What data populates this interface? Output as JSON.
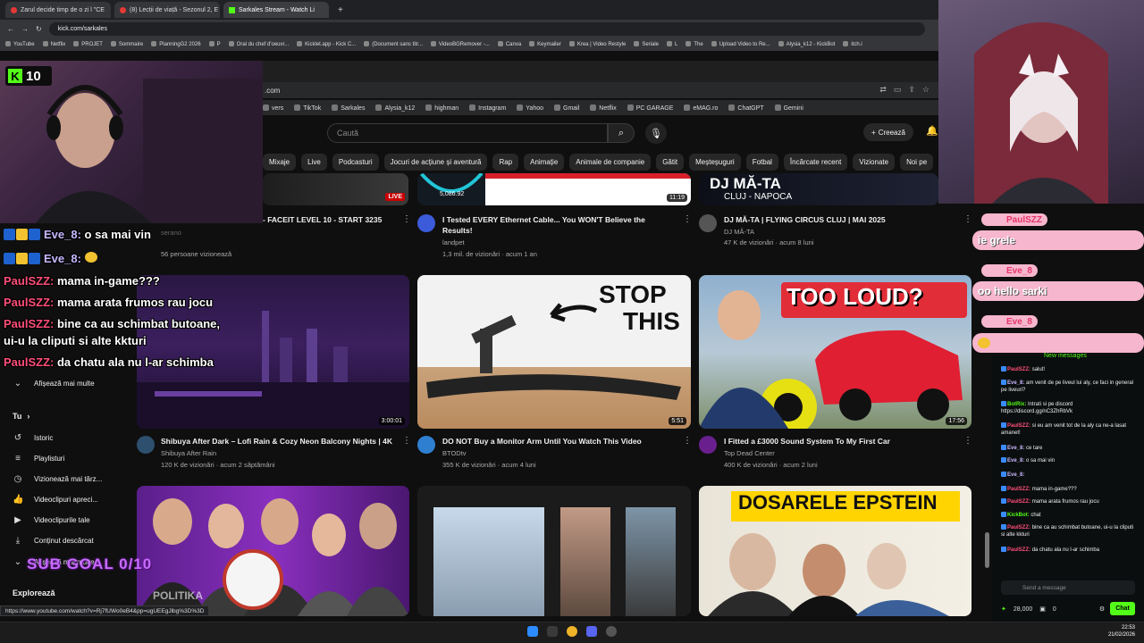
{
  "outer_browser": {
    "tabs": [
      {
        "label": "Zarul decide timp de o zi l \"CE",
        "icon": "youtube-icon"
      },
      {
        "label": "(8) Lecții de viață - Sezonul 2, E",
        "icon": "youtube-icon"
      },
      {
        "label": "Sarkales Stream - Watch Li",
        "icon": "kick-icon"
      }
    ],
    "url": "kick.com/sarkales",
    "bookmarks": [
      "YouTube",
      "Netflix",
      "PROJET",
      "Sommaire",
      "PlanningG2 2026",
      "P",
      "Oral du chef d'oeuvr...",
      "Kicklet.app - Kick C...",
      "(Document sans titr...",
      "VideoBGRemover -...",
      "Canva",
      "Keymailer",
      "Krea | Video Restyle",
      "Seriale",
      "L",
      "The",
      "Upload Video to Re...",
      "Alysia_k12 - KickBot",
      "itch.i"
    ]
  },
  "inner_browser": {
    "url": ".com",
    "bookmarks": [
      "vers",
      "TikTok",
      "Sarkales",
      "Alysia_k12",
      "highman",
      "Instagram",
      "Yahoo",
      "Gmail",
      "Netflix",
      "PC GARAGE",
      "eMAG.ro",
      "ChatGPT",
      "Gemini"
    ]
  },
  "youtube": {
    "search_placeholder": "Caută",
    "create_label": "Creează",
    "chips": [
      "Mixaje",
      "Live",
      "Podcasturi",
      "Jocuri de acțiune și aventură",
      "Rap",
      "Animație",
      "Animale de companie",
      "Gătit",
      "Meșteșuguri",
      "Fotbal",
      "Încărcate recent",
      "Vizionate",
      "Noi pe"
    ],
    "row1": [
      {
        "title": "- FACEIT LEVEL 10 - START 3235",
        "channel": "serano",
        "meta": "56 persoane vizionează",
        "live_badge": "LIVE"
      },
      {
        "title": "I Tested EVERY Ethernet Cable... You WON'T Believe the Results!",
        "channel": "landpet",
        "meta": "1,3 mil. de vizionări · acum 1 an",
        "thumb_text": "5,086.92"
      },
      {
        "title": "DJ MĂ-TA | FLYING CIRCUS CLUJ | MAI 2025",
        "channel": "DJ MĂ-TA",
        "meta": "47 K de vizionări · acum 8 luni",
        "duration": "11:19",
        "thumb_text": "DJ MĂ-TA",
        "thumb_sub": "CLUJ - NAPOCA"
      }
    ],
    "row2": [
      {
        "title": "Shibuya After Dark – Lofi Rain & Cozy Neon Balcony Nights | 4K",
        "channel": "Shibuya After Rain",
        "meta": "120 K de vizionări · acum 2 săptămâni",
        "duration": "3:00:01"
      },
      {
        "title": "DO NOT Buy a Monitor Arm Until You Watch This Video",
        "channel": "BTODtv",
        "meta": "355 K de vizionări · acum 4 luni",
        "duration": "5:51",
        "thumb_text_1": "STOP",
        "thumb_text_2": "THIS"
      },
      {
        "title": "I Fitted a £3000 Sound System To My First Car",
        "channel": "Top Dead Center",
        "meta": "400 K de vizionări · acum 2 luni",
        "duration": "17:56",
        "thumb_text": "TOO LOUD?"
      }
    ],
    "row3": [
      {
        "thumb_text": "POLITIKA"
      },
      {},
      {
        "thumb_text": "DOSARELE EPSTEIN"
      }
    ],
    "sidebar": {
      "show_more": "Afișează mai multe",
      "you": "Tu",
      "items": [
        "Istoric",
        "Playlisturi",
        "Vizionează mai târz...",
        "Videoclipuri apreci...",
        "Videoclipurile tale",
        "Conținut descărcat",
        "Afișează mai multe"
      ],
      "explore": "Explorează"
    },
    "status_url": "https://www.youtube.com/watch?v=Rj7fUWo0eB4&pp=ugUEEgJlbg%3D%3D"
  },
  "stream_overlay": {
    "kick_badge_number": "10",
    "sub_goal": "SUB GOAL 0/10",
    "chat": [
      {
        "name": "Eve_8:",
        "text": "o sa mai vin"
      },
      {
        "name": "Eve_8:",
        "text": ""
      },
      {
        "name": "PaulSZZ:",
        "text": "mama in-game???"
      },
      {
        "name": "PaulSZZ:",
        "text": "mama arata frumos rau jocu"
      },
      {
        "name": "PaulSZZ:",
        "text": "bine ca au schimbat butoane,"
      },
      {
        "name": "",
        "text": "ui-u la cliputi si alte kkturi"
      },
      {
        "name": "PaulSZZ:",
        "text": "da chatu ala nu l-ar schimba"
      }
    ],
    "popups": [
      {
        "name": "PaulSZZ",
        "text": "ie grele"
      },
      {
        "name": "Eve_8",
        "text": "oo hello sarki"
      },
      {
        "name": "Eve_8",
        "text": ""
      }
    ]
  },
  "kick_chat": {
    "new_messages": "New messages",
    "lines": [
      {
        "name": "PaulSZZ:",
        "text": "salut!"
      },
      {
        "name": "Eve_8:",
        "text": "am venit de pe liveul lui aly, ce faci in general pe liveuri?"
      },
      {
        "name": "BotRix:",
        "text": "Intrati si pe discord https://discord.gg/nC3ZhRbVk"
      },
      {
        "name": "PaulSZZ:",
        "text": "si eu am venit tot de la aly ca ne-a lasat amanet!"
      },
      {
        "name": "Eve_8:",
        "text": "ce tare"
      },
      {
        "name": "Eve_8:",
        "text": "o sa mai vin"
      },
      {
        "name": "Eve_8:",
        "text": ""
      },
      {
        "name": "PaulSZZ:",
        "text": "mama in-game???"
      },
      {
        "name": "PaulSZZ:",
        "text": "mama arata frumos rau jocu"
      },
      {
        "name": "KickBot:",
        "text": "chat"
      },
      {
        "name": "PaulSZZ:",
        "text": "bine ca au schimbat butoane, ui-u la cliputi si alte kkturi"
      },
      {
        "name": "PaulSZZ:",
        "text": "da chatu ala nu l-ar schimba"
      }
    ],
    "input_placeholder": "Send a message",
    "points": "28,000",
    "zero": "0",
    "chat_button": "Chat"
  },
  "taskbar": {
    "time": "22:53",
    "date": "21/02/2026"
  },
  "colors": {
    "kick_green": "#53fc18",
    "yt_red": "#ff0000",
    "overlay_purple": "#c86bff",
    "popup_pink": "#f6b6cd"
  }
}
